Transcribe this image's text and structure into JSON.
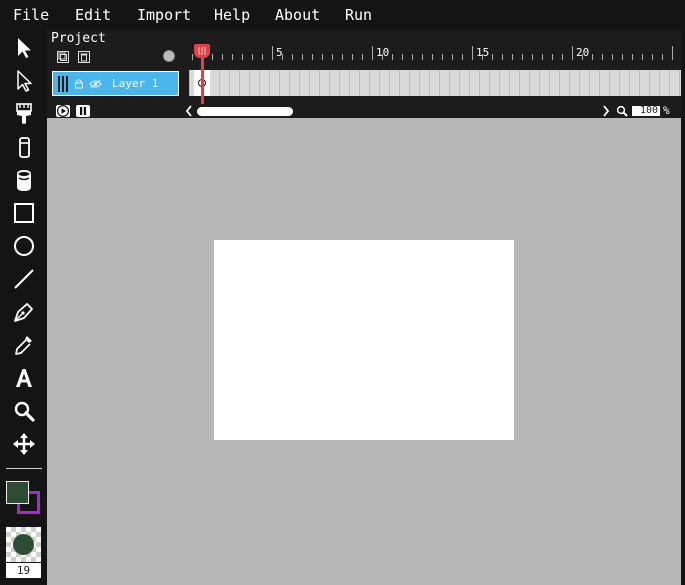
{
  "menu": {
    "items": [
      {
        "id": "file",
        "label": "File"
      },
      {
        "id": "edit",
        "label": "Edit"
      },
      {
        "id": "import",
        "label": "Import"
      },
      {
        "id": "help",
        "label": "Help"
      },
      {
        "id": "about",
        "label": "About"
      },
      {
        "id": "run",
        "label": "Run"
      }
    ]
  },
  "toolbar": {
    "tools": [
      {
        "name": "select-tool",
        "icon": "arrow-icon"
      },
      {
        "name": "subselect-tool",
        "icon": "hollow-arrow-icon"
      },
      {
        "name": "brush-tool",
        "icon": "brush-icon"
      },
      {
        "name": "eraser-tool",
        "icon": "eraser-icon"
      },
      {
        "name": "paint-bucket-tool",
        "icon": "bucket-icon"
      },
      {
        "name": "rectangle-tool",
        "icon": "rectangle-icon"
      },
      {
        "name": "ellipse-tool",
        "icon": "ellipse-icon"
      },
      {
        "name": "line-tool",
        "icon": "line-icon"
      },
      {
        "name": "pen-tool",
        "icon": "pen-icon"
      },
      {
        "name": "eyedropper-tool",
        "icon": "eyedropper-icon"
      },
      {
        "name": "text-tool",
        "icon": "text-icon"
      },
      {
        "name": "zoom-tool",
        "icon": "magnifier-icon"
      },
      {
        "name": "pan-tool",
        "icon": "move-icon"
      }
    ],
    "fill_color": "#2e4b34",
    "stroke_color": "#a32cc4",
    "brush_size": "19"
  },
  "timeline": {
    "project_title": "Project",
    "ruler_numbers": [
      "5",
      "10",
      "15",
      "20"
    ],
    "layer": {
      "name": "Layer 1"
    },
    "zoom_value": "100",
    "zoom_unit": "%"
  }
}
